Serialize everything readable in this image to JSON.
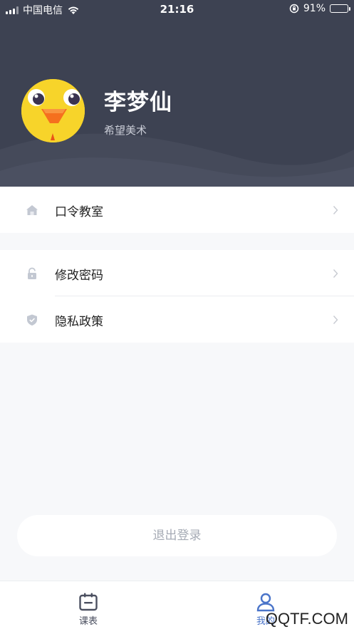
{
  "status_bar": {
    "carrier": "中国电信",
    "time": "21:16",
    "battery_percent": "91%",
    "battery_level": 0.91
  },
  "profile": {
    "name": "李梦仙",
    "organization": "希望美术"
  },
  "menu_group_1": [
    {
      "label": "口令教室",
      "icon": "home-icon"
    }
  ],
  "menu_group_2": [
    {
      "label": "修改密码",
      "icon": "lock-icon"
    },
    {
      "label": "隐私政策",
      "icon": "shield-icon"
    }
  ],
  "logout_label": "退出登录",
  "tabbar": {
    "tabs": [
      {
        "label": "课表",
        "icon": "calendar-icon",
        "active": false
      },
      {
        "label": "我的",
        "icon": "user-icon",
        "active": true
      }
    ]
  },
  "watermark": "QQTF.COM",
  "colors": {
    "header_bg": "#3d4252",
    "active_tab": "#4a74c9",
    "inactive_tab": "#4b5060",
    "menu_icon": "#c3c8d2"
  }
}
